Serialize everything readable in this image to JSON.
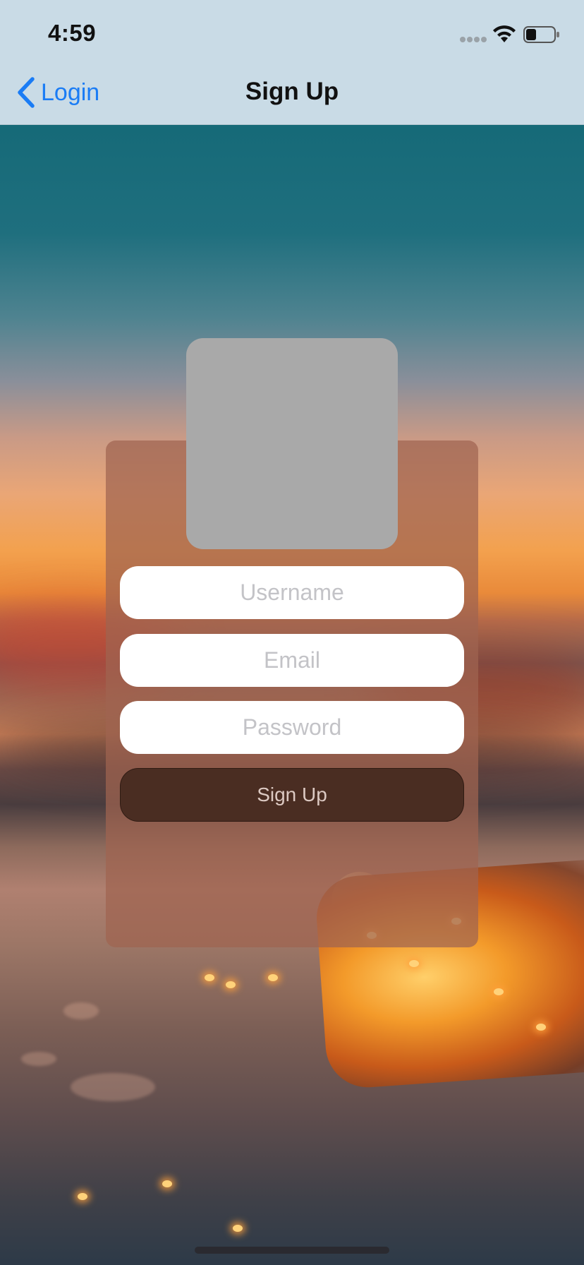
{
  "status_bar": {
    "time": "4:59"
  },
  "nav_bar": {
    "back_label": "Login",
    "title": "Sign Up",
    "tint_color": "#1a7cf5"
  },
  "form": {
    "username_placeholder": "Username",
    "email_placeholder": "Email",
    "password_placeholder": "Password",
    "signup_label": "Sign Up"
  },
  "icons": [
    "chevron-left-icon",
    "wifi-icon",
    "battery-icon",
    "signal-icon"
  ],
  "colors": {
    "nav_background": "#c9dbe6",
    "card_background": "rgba(160,100,80,0.72)",
    "button_background": "#4a2d22",
    "image_placeholder": "#a9a9a9"
  }
}
